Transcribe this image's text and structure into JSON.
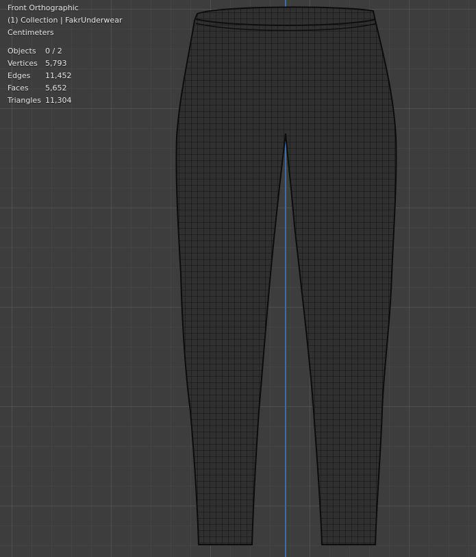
{
  "viewport": {
    "view_name": "Front Orthographic",
    "collection": "(1) Collection | FakrUnderwear",
    "units": "Centimeters"
  },
  "stats": [
    {
      "label": "Objects",
      "value": "0 / 2"
    },
    {
      "label": "Vertices",
      "value": "5,793"
    },
    {
      "label": "Edges",
      "value": "11,452"
    },
    {
      "label": "Faces",
      "value": "5,652"
    },
    {
      "label": "Triangles",
      "value": "11,304"
    }
  ],
  "colors": {
    "background": "#3d3d3d",
    "grid": "#5a5a5a",
    "z_axis": "#3b6bb0",
    "mesh_fill": "#2e2e2e",
    "wireframe": "#111111"
  },
  "icons": {
    "mesh": "wireframe-mesh-icon"
  }
}
